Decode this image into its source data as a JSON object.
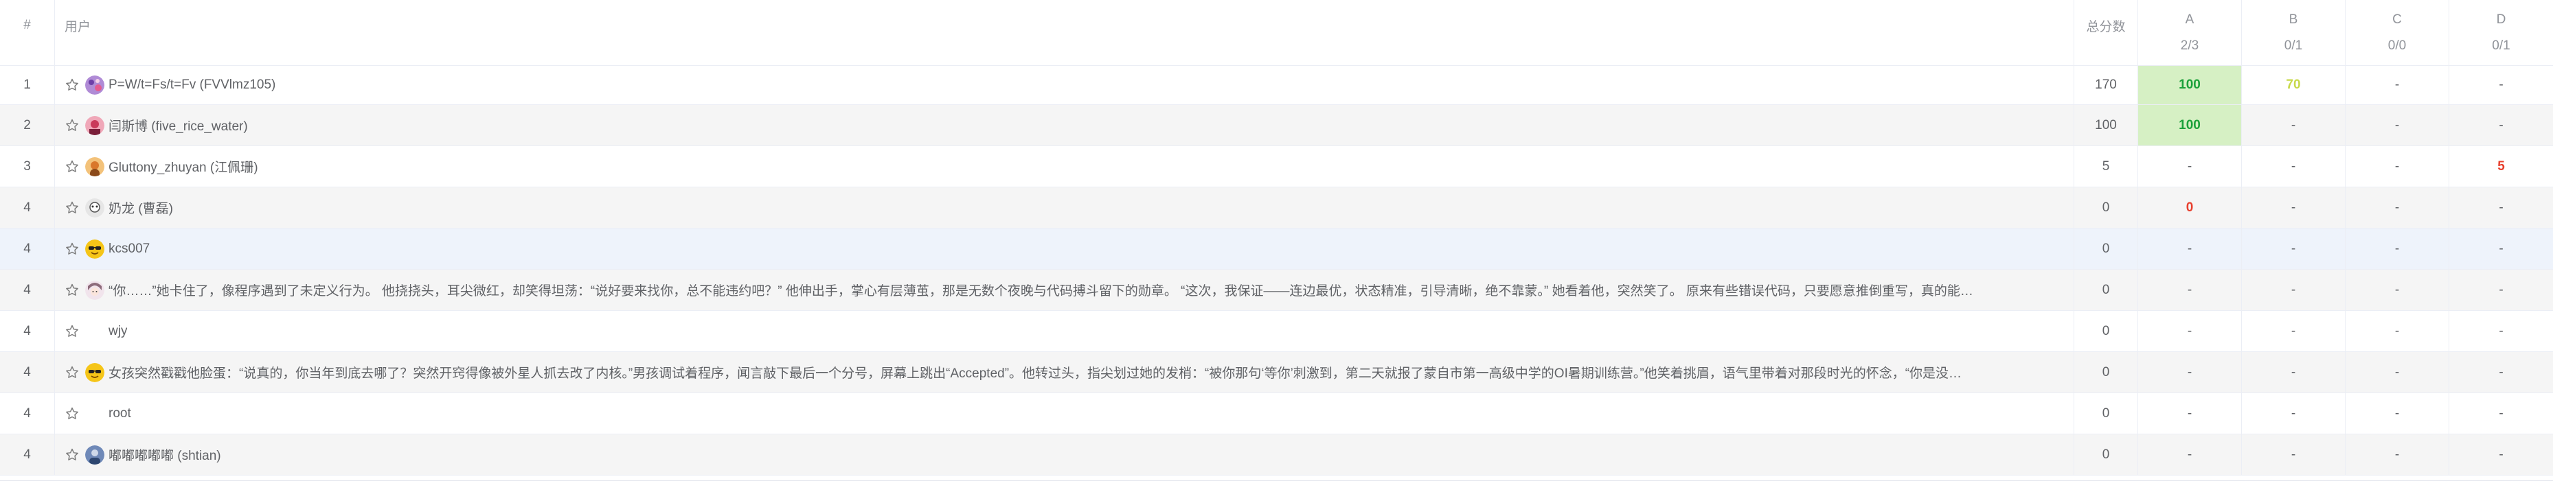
{
  "header": {
    "rank": "#",
    "user": "用户",
    "total": "总分数",
    "problems": [
      {
        "label": "A",
        "stat": "2/3"
      },
      {
        "label": "B",
        "stat": "0/1"
      },
      {
        "label": "C",
        "stat": "0/0"
      },
      {
        "label": "D",
        "stat": "0/1"
      }
    ]
  },
  "colors": {
    "full_score_bg": "#d6f0c4",
    "green": "#1ba13a",
    "lime": "#c8d94a",
    "red": "#e8402e"
  },
  "rows": [
    {
      "rank": "1",
      "name": "P=W/t=Fs/t=Fv (FVVlmz105)",
      "total": "170",
      "a": "100",
      "b": "70",
      "c": "-",
      "d": "-",
      "avatar": "purple-avatar"
    },
    {
      "rank": "2",
      "name": "闫斯博 (five_rice_water)",
      "total": "100",
      "a": "100",
      "b": "-",
      "c": "-",
      "d": "-",
      "avatar": "pink-avatar"
    },
    {
      "rank": "3",
      "name": "Gluttony_zhuyan (江佩珊)",
      "total": "5",
      "a": "-",
      "b": "-",
      "c": "-",
      "d": "5",
      "avatar": "orange-avatar"
    },
    {
      "rank": "4",
      "name": "奶龙 (曹磊)",
      "total": "0",
      "a": "0",
      "b": "-",
      "c": "-",
      "d": "-",
      "avatar": "gray-avatar"
    },
    {
      "rank": "4",
      "name": "kcs007",
      "total": "0",
      "a": "-",
      "b": "-",
      "c": "-",
      "d": "-",
      "avatar": "sunglasses-avatar"
    },
    {
      "rank": "4",
      "name": "“你……”她卡住了，像程序遇到了未定义行为。 他挠挠头，耳尖微红，却笑得坦荡：“说好要来找你，总不能违约吧？” 他伸出手，掌心有层薄茧，那是无数个夜晚与代码搏斗留下的勋章。 “这次，我保证——连边最优，状态精准，引导清晰，绝不靠蒙。” 她看着他，突然笑了。 原来有些错误代码，只要愿意推倒重写，真的能…",
      "total": "0",
      "a": "-",
      "b": "-",
      "c": "-",
      "d": "-",
      "avatar": "anime-avatar"
    },
    {
      "rank": "4",
      "name": "wjy",
      "total": "0",
      "a": "-",
      "b": "-",
      "c": "-",
      "d": "-",
      "avatar": ""
    },
    {
      "rank": "4",
      "name": "女孩突然戳戳他脸蛋：“说真的，你当年到底去哪了？突然开窍得像被外星人抓去改了内核。”男孩调试着程序，闻言敲下最后一个分号，屏幕上跳出“Accepted”。他转过头，指尖划过她的发梢：“被你那句‘等你’刺激到，第二天就报了蒙自市第一高级中学的OI暑期训练营。”他笑着挑眉，语气里带着对那段时光的怀念，“你是没…",
      "total": "0",
      "a": "-",
      "b": "-",
      "c": "-",
      "d": "-",
      "avatar": "sunglasses-avatar"
    },
    {
      "rank": "4",
      "name": "root",
      "total": "0",
      "a": "-",
      "b": "-",
      "c": "-",
      "d": "-",
      "avatar": ""
    },
    {
      "rank": "4",
      "name": "嘟嘟嘟嘟嘟 (shtian)",
      "total": "0",
      "a": "-",
      "b": "-",
      "c": "-",
      "d": "-",
      "avatar": "blue-avatar"
    }
  ]
}
